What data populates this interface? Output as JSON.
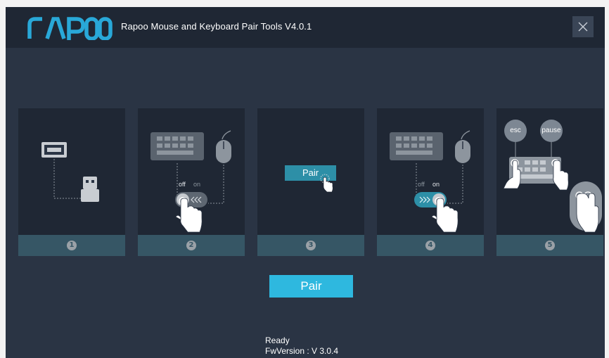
{
  "app": {
    "logo_text": "rapoo",
    "title": "Rapoo Mouse and Keyboard Pair Tools V4.0.1"
  },
  "titlebar": {
    "close_icon": "close-icon"
  },
  "steps": [
    {
      "number": "1",
      "icons": [
        "usb-port-icon",
        "usb-receiver-icon"
      ]
    },
    {
      "number": "2",
      "icons": [
        "keyboard-icon",
        "mouse-icon",
        "toggle-switch-icon",
        "hand-pointer-icon"
      ],
      "switch": {
        "off": "off",
        "on": "on",
        "state": "off"
      }
    },
    {
      "number": "3",
      "icons": [
        "hand-cursor-icon"
      ],
      "pair_label": "Pair"
    },
    {
      "number": "4",
      "icons": [
        "keyboard-icon",
        "mouse-icon",
        "toggle-switch-icon",
        "hand-pointer-icon"
      ],
      "switch": {
        "off": "off",
        "on": "on",
        "state": "on"
      }
    },
    {
      "number": "5",
      "icons": [
        "keyboard-icon",
        "mouse-icon",
        "hand-pointer-icon"
      ],
      "keys": [
        "esc",
        "pause"
      ]
    }
  ],
  "pair_button": "Pair",
  "status": {
    "state": "Ready",
    "fw_version": "FwVersion : V 3.0.4"
  },
  "colors": {
    "background": "#2a3444",
    "titlebar": "#1f2734",
    "panel": "#1f2734",
    "panel_footer": "#365665",
    "accent": "#2eb8df",
    "logo": "#29a8d8"
  }
}
